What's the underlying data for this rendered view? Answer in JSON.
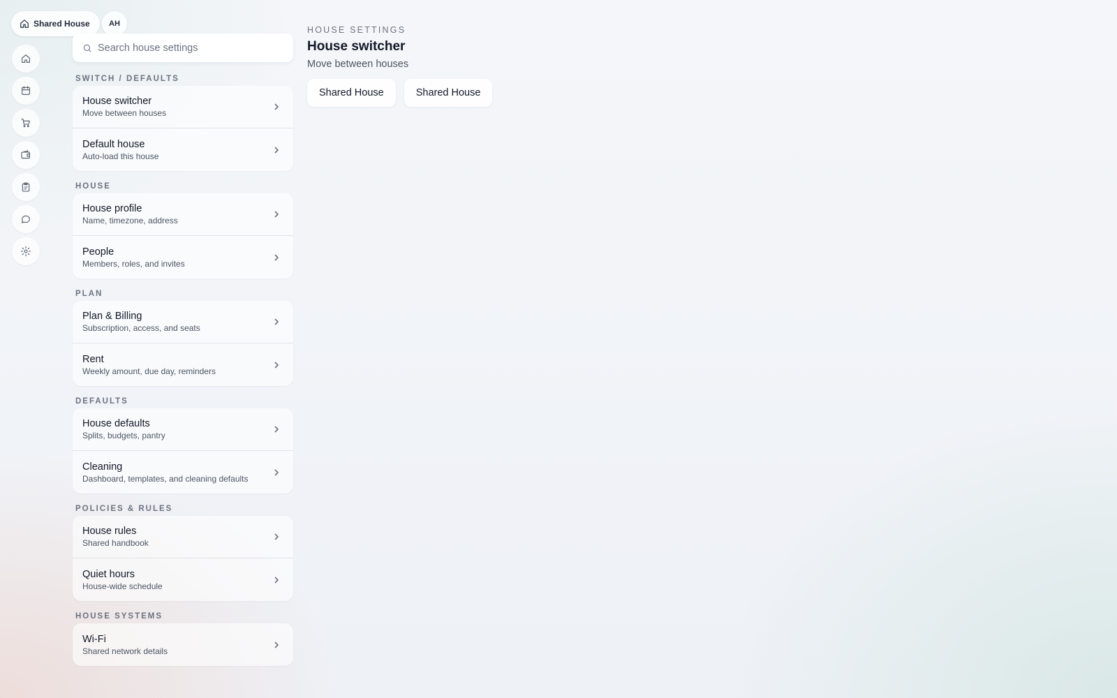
{
  "header": {
    "house_chip_label": "Shared House",
    "avatar_initials": "AH"
  },
  "rail": {
    "icons": [
      "home-icon",
      "calendar-icon",
      "cart-icon",
      "wallet-icon",
      "clipboard-icon",
      "chat-icon",
      "gear-icon"
    ]
  },
  "search": {
    "placeholder": "Search house settings"
  },
  "sections": [
    {
      "label": "SWITCH / DEFAULTS",
      "items": [
        {
          "title": "House switcher",
          "subtitle": "Move between houses"
        },
        {
          "title": "Default house",
          "subtitle": "Auto-load this house"
        }
      ]
    },
    {
      "label": "HOUSE",
      "items": [
        {
          "title": "House profile",
          "subtitle": "Name, timezone, address"
        },
        {
          "title": "People",
          "subtitle": "Members, roles, and invites"
        }
      ]
    },
    {
      "label": "PLAN",
      "items": [
        {
          "title": "Plan & Billing",
          "subtitle": "Subscription, access, and seats"
        },
        {
          "title": "Rent",
          "subtitle": "Weekly amount, due day, reminders"
        }
      ]
    },
    {
      "label": "DEFAULTS",
      "items": [
        {
          "title": "House defaults",
          "subtitle": "Splits, budgets, pantry"
        },
        {
          "title": "Cleaning",
          "subtitle": "Dashboard, templates, and cleaning defaults"
        }
      ]
    },
    {
      "label": "POLICIES & RULES",
      "items": [
        {
          "title": "House rules",
          "subtitle": "Shared handbook"
        },
        {
          "title": "Quiet hours",
          "subtitle": "House-wide schedule"
        }
      ]
    },
    {
      "label": "HOUSE SYSTEMS",
      "items": [
        {
          "title": "Wi-Fi",
          "subtitle": "Shared network details"
        }
      ]
    }
  ],
  "main": {
    "eyebrow": "HOUSE SETTINGS",
    "title": "House switcher",
    "subtitle": "Move between houses",
    "houses": [
      "Shared House",
      "Shared House"
    ]
  }
}
